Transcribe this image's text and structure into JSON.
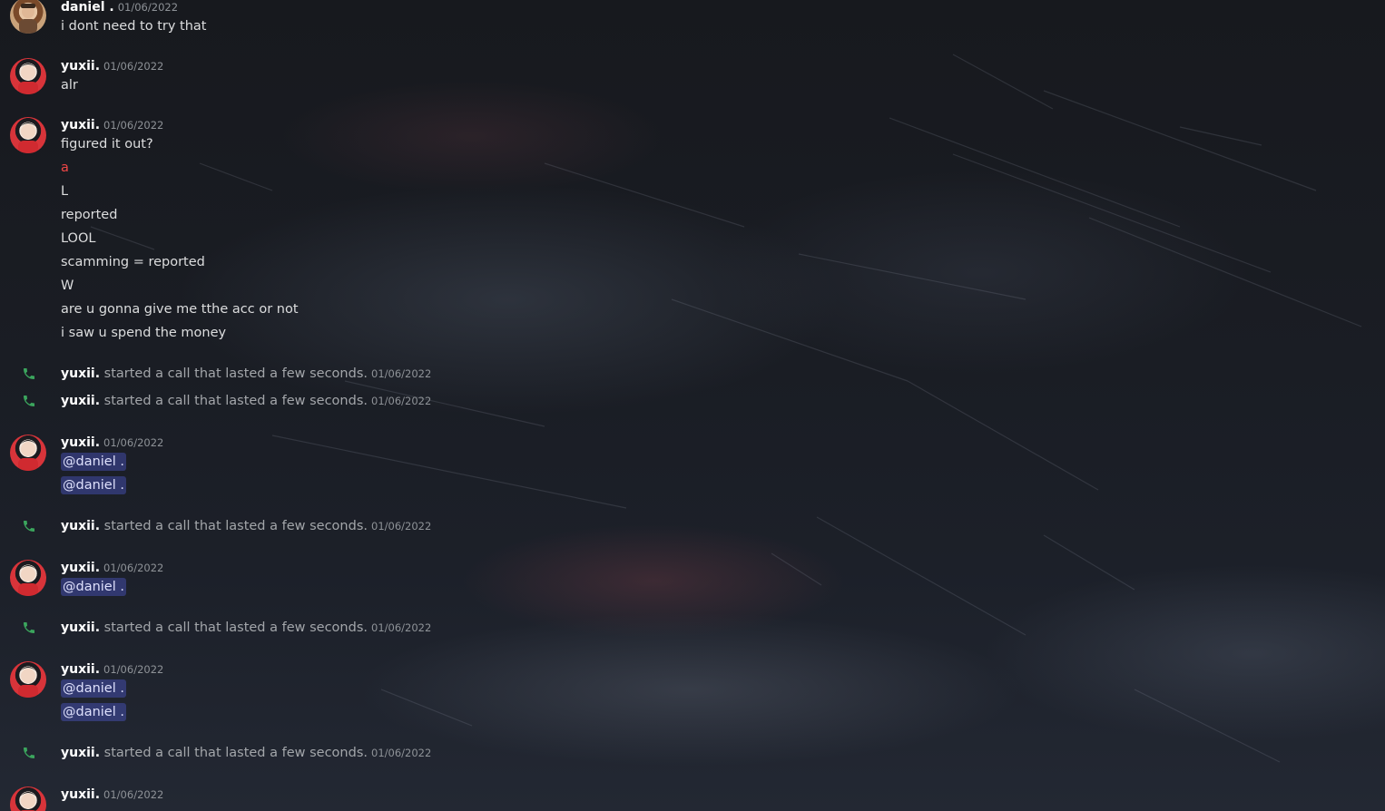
{
  "messages": {
    "m1": {
      "author": "daniel .",
      "timestamp": "01/06/2022",
      "lines": [
        "i dont need to try that"
      ]
    },
    "m2": {
      "author": "yuxii.",
      "timestamp": "01/06/2022",
      "lines": [
        "alr"
      ]
    },
    "m3": {
      "author": "yuxii.",
      "timestamp": "01/06/2022",
      "lines": [
        "figured it out?",
        "a",
        "L",
        "reported",
        "LOOL",
        "scamming = reported",
        "W",
        "are u gonna give me tthe acc or not",
        "i saw u spend the money"
      ]
    },
    "m4": {
      "author": "yuxii.",
      "timestamp": "01/06/2022",
      "mentions": [
        "@daniel .",
        "@daniel ."
      ]
    },
    "m5": {
      "author": "yuxii.",
      "timestamp": "01/06/2022",
      "mentions": [
        "@daniel ."
      ]
    },
    "m6": {
      "author": "yuxii.",
      "timestamp": "01/06/2022",
      "mentions": [
        "@daniel .",
        "@daniel ."
      ]
    },
    "m7": {
      "author": "yuxii.",
      "timestamp": "01/06/2022"
    }
  },
  "calls": {
    "c1": {
      "author": "yuxii.",
      "text": "started a call that lasted a few seconds.",
      "timestamp": "01/06/2022"
    },
    "c2": {
      "author": "yuxii.",
      "text": "started a call that lasted a few seconds.",
      "timestamp": "01/06/2022"
    },
    "c3": {
      "author": "yuxii.",
      "text": "started a call that lasted a few seconds.",
      "timestamp": "01/06/2022"
    },
    "c4": {
      "author": "yuxii.",
      "text": "started a call that lasted a few seconds.",
      "timestamp": "01/06/2022"
    },
    "c5": {
      "author": "yuxii.",
      "text": "started a call that lasted a few seconds.",
      "timestamp": "01/06/2022"
    }
  },
  "colors": {
    "call_icon": "#3ba55d",
    "mention_bg": "#5865f2",
    "red_text": "#f04747"
  }
}
